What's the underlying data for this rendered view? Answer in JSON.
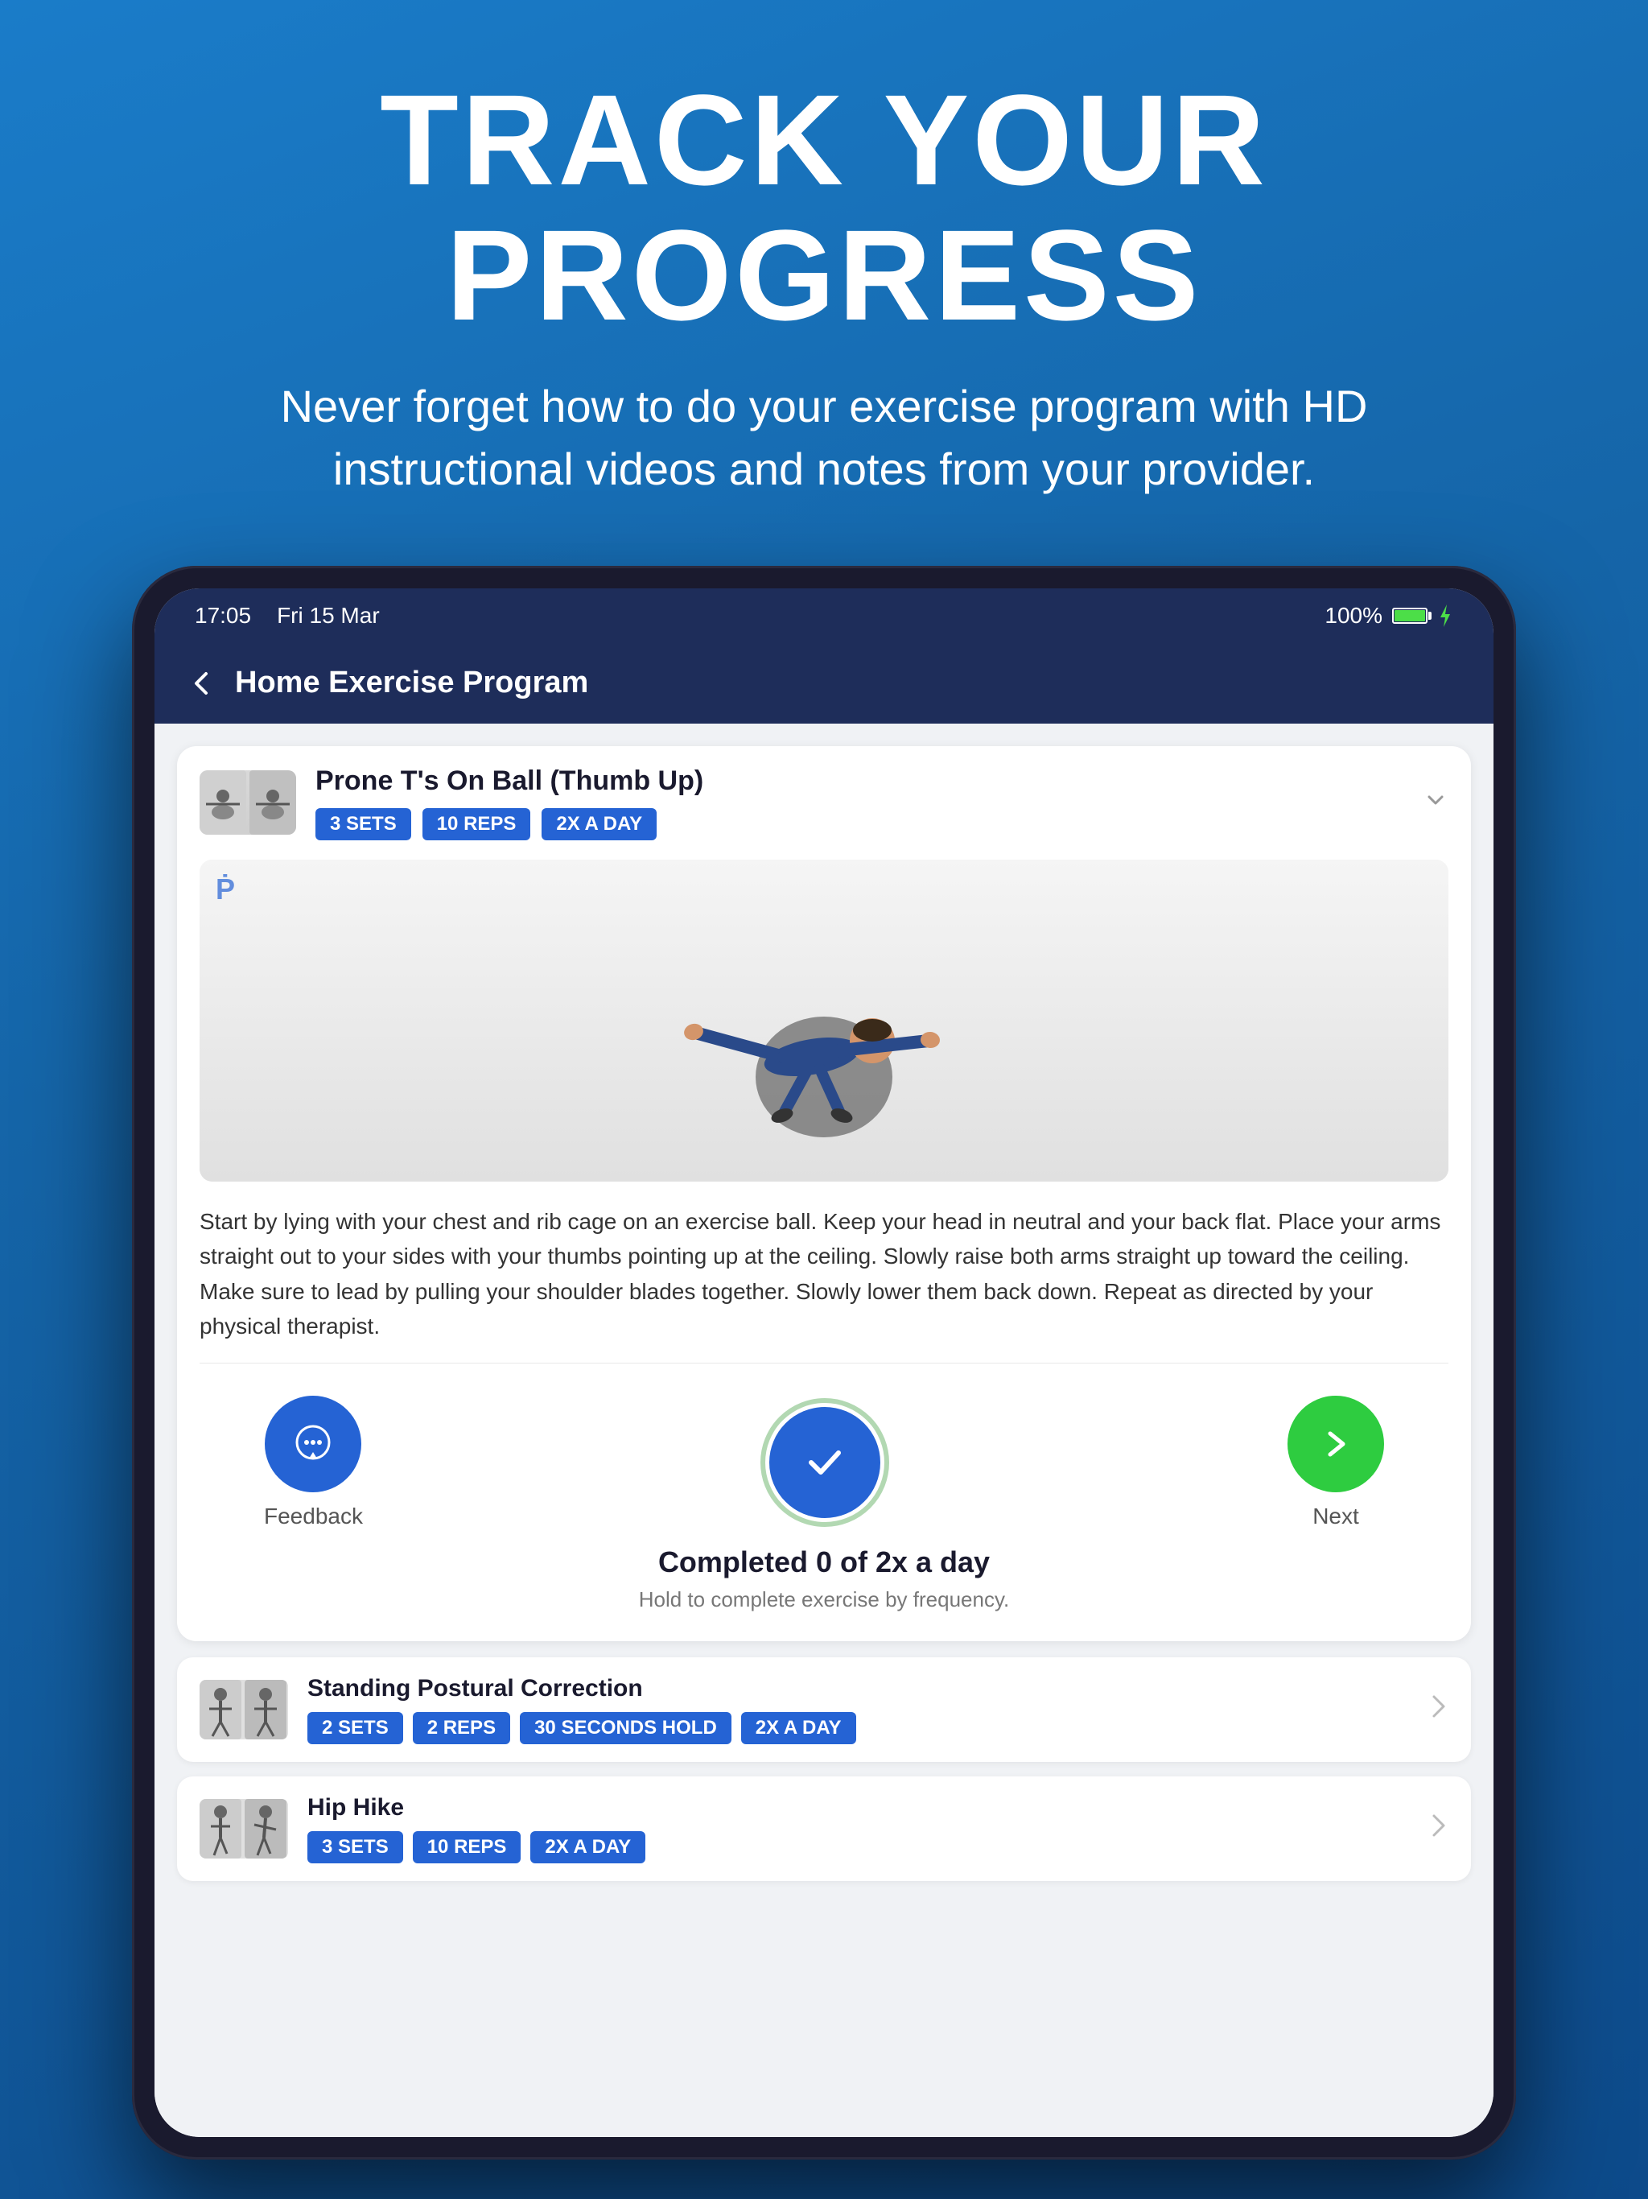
{
  "page": {
    "title": "TRACK YOUR PROGRESS",
    "subtitle": "Never forget how to do your exercise program with HD instructional videos and notes from your provider."
  },
  "status_bar": {
    "time": "17:05",
    "date": "Fri 15 Mar",
    "battery_pct": "100%"
  },
  "app_bar": {
    "title": "Home Exercise Program",
    "back_label": "←"
  },
  "active_exercise": {
    "name": "Prone T's On Ball (Thumb Up)",
    "tags": [
      "3 SETS",
      "10 REPS",
      "2X A DAY"
    ],
    "description": "Start by lying with your chest and rib cage on an exercise ball. Keep your head in neutral and your back flat. Place your arms straight out to your sides with your thumbs pointing up at the ceiling. Slowly raise both arms straight up toward the ceiling. Make sure to lead by pulling your shoulder blades together. Slowly lower them back down. Repeat as directed by your physical therapist.",
    "watermark": "P̈"
  },
  "actions": {
    "feedback_label": "Feedback",
    "next_label": "Next",
    "complete_label": "✓"
  },
  "completion": {
    "title": "Completed 0 of 2x a day",
    "subtitle": "Hold to complete exercise by frequency."
  },
  "exercise_list": [
    {
      "name": "Standing Postural Correction",
      "tags": [
        "2 SETS",
        "2 REPS",
        "30 SECONDS HOLD",
        "2X A DAY"
      ]
    },
    {
      "name": "Hip Hike",
      "tags": [
        "3 SETS",
        "10 REPS",
        "2X A DAY"
      ]
    }
  ]
}
